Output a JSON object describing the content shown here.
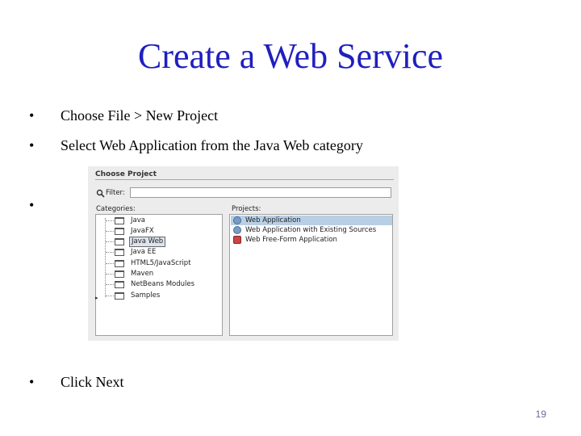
{
  "slide": {
    "title": "Create a Web Service",
    "bullet_char": "•",
    "bullets": [
      "Choose File > New Project",
      "Select Web Application from the Java Web category",
      "",
      "Click Next"
    ],
    "page_number": "19"
  },
  "dialog": {
    "header": "Choose Project",
    "filter_label": "Filter:",
    "filter_value": "",
    "categories_label": "Categories:",
    "projects_label": "Projects:",
    "categories": [
      "Java",
      "JavaFX",
      "Java Web",
      "Java EE",
      "HTML5/JavaScript",
      "Maven",
      "NetBeans Modules",
      "Samples"
    ],
    "selected_category": "Java Web",
    "projects": [
      "Web Application",
      "Web Application with Existing Sources",
      "Web Free-Form Application"
    ],
    "selected_project": "Web Application"
  }
}
